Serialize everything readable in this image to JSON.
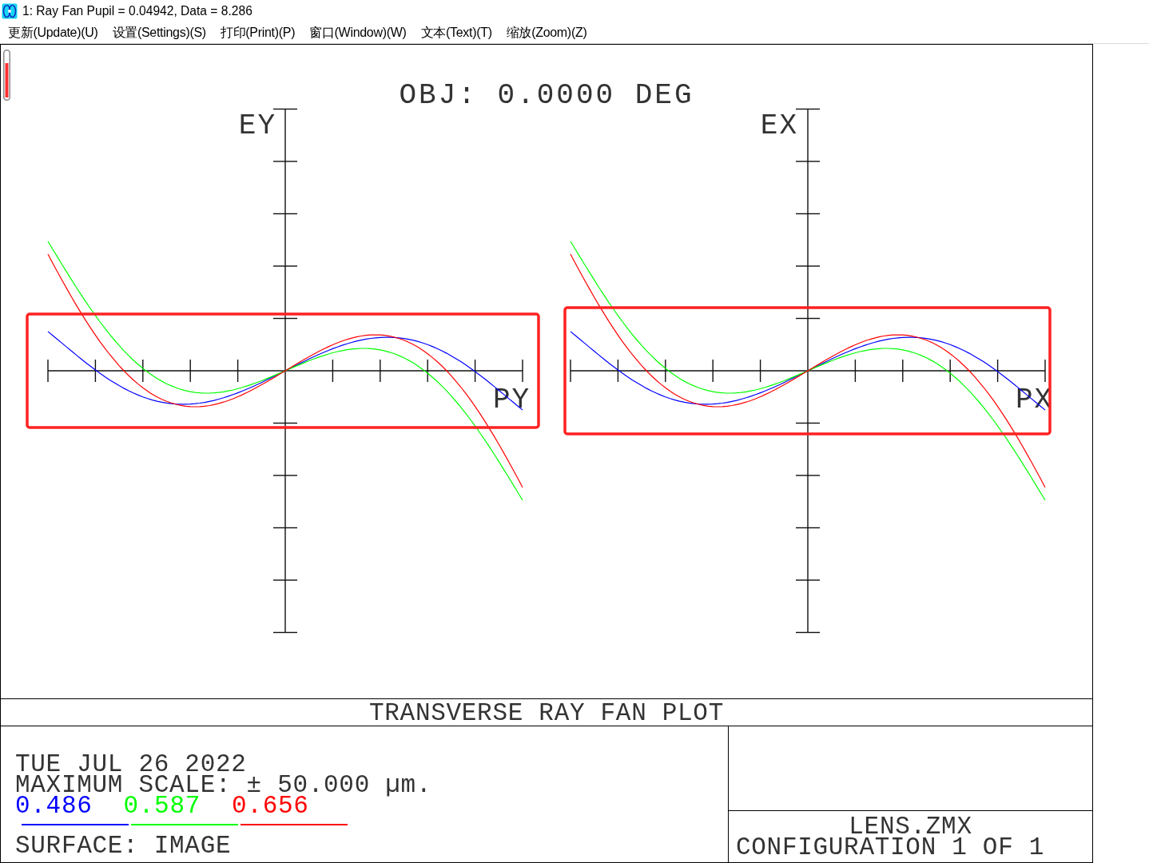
{
  "window": {
    "title": "1: Ray Fan Pupil = 0.04942, Data = 8.286"
  },
  "menu": [
    "更新(Update)(U)",
    "设置(Settings)(S)",
    "打印(Print)(P)",
    "窗口(Window)(W)",
    "文本(Text)(T)",
    "缩放(Zoom)(Z)"
  ],
  "plot": {
    "title": "OBJ: 0.0000 DEG",
    "panels": [
      {
        "y_axis_label": "EY",
        "x_axis_label": "PY",
        "highlighted": true
      },
      {
        "y_axis_label": "EX",
        "x_axis_label": "PX",
        "highlighted": true
      }
    ]
  },
  "plot_name": "TRANSVERSE RAY FAN PLOT",
  "footer": {
    "date": "TUE JUL 26 2022",
    "scale": "MAXIMUM SCALE: ± 50.000 µm.",
    "wavelengths": [
      {
        "label": "0.486",
        "color": "#0000ff"
      },
      {
        "label": "0.587",
        "color": "#00ff00"
      },
      {
        "label": "0.656",
        "color": "#ff0000"
      }
    ],
    "surface": "SURFACE: IMAGE",
    "file": "LENS.ZMX",
    "configuration": "CONFIGURATION 1 OF 1"
  }
}
